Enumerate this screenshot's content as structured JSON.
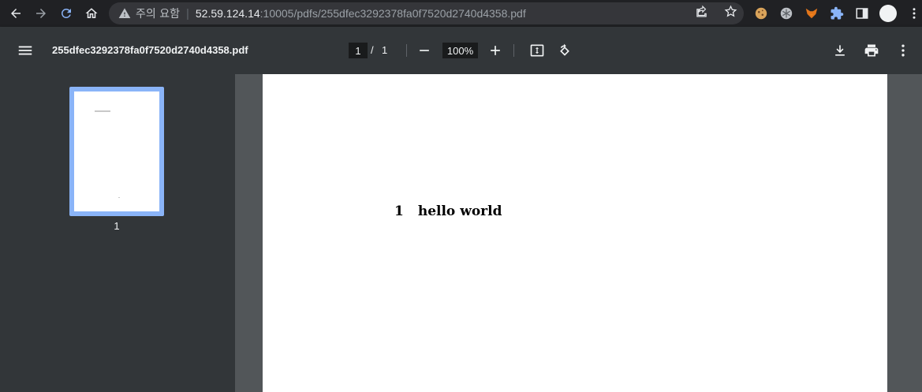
{
  "browser": {
    "security_warning": "주의 요함",
    "url_host": "52.59.124.14",
    "url_rest": ":10005/pdfs/255dfec3292378fa0f7520d2740d4358.pdf",
    "icons": [
      "back-arrow-icon",
      "forward-arrow-icon",
      "reload-icon",
      "home-icon",
      "warning-icon",
      "share-icon",
      "bookmark-star-icon",
      "cookie-extension-icon",
      "snowflake-extension-icon",
      "fox-extension-icon",
      "puzzle-extensions-icon",
      "side-panel-icon",
      "profile-avatar"
    ]
  },
  "pdf_toolbar": {
    "title": "255dfec3292378fa0f7520d2740d4358.pdf",
    "current_page": "1",
    "page_separator": "/",
    "total_pages": "1",
    "zoom": "100%"
  },
  "sidebar": {
    "thumbnails": [
      {
        "label": "1"
      }
    ]
  },
  "document": {
    "section_number": "1",
    "section_title": "hello world"
  },
  "colors": {
    "toolbar_bg": "#323639",
    "viewer_bg": "#525659",
    "thumb_selected": "#8ab4f8",
    "browser_bg": "#202124"
  }
}
